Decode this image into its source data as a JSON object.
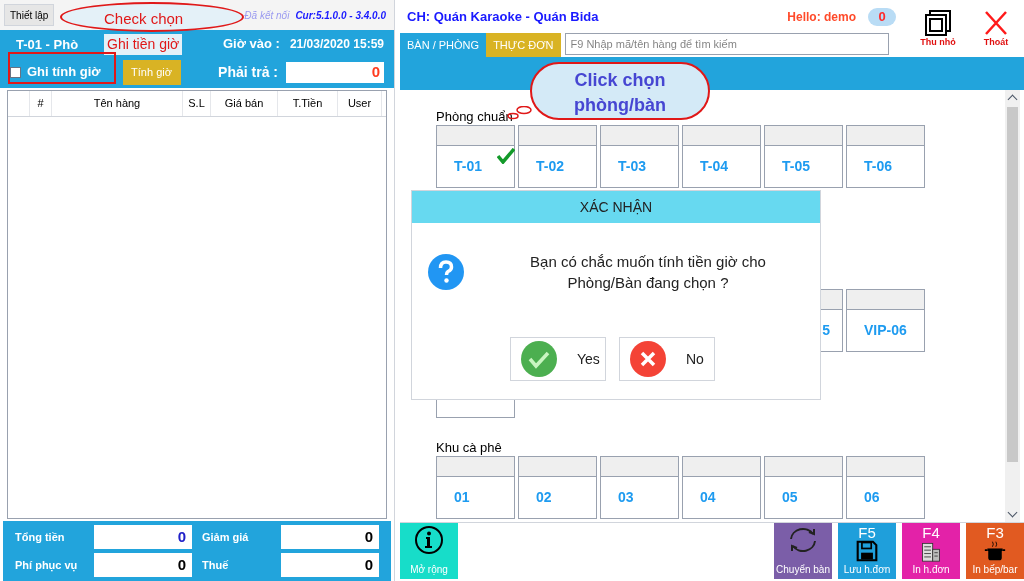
{
  "top_bar": {
    "menu_tab": "Thiết lập",
    "connection": "Đã kết nối",
    "version": "Cur:5.1.0.0 - 3.4.0.0"
  },
  "order_panel": {
    "title": "T-01 - Phò",
    "checkin_label": "Giờ vào :",
    "checkin_time": "21/03/2020 15:59",
    "timer_checkbox": {
      "label": "Ghi tính giờ",
      "checked": false
    },
    "timer_button": "Tính giờ",
    "amount_due_label": "Phải trả :",
    "amount_due": "0"
  },
  "order_table": {
    "columns": [
      "#",
      "Tên hàng",
      "S.L",
      "Giá bán",
      "T.Tiền",
      "User"
    ]
  },
  "totals": [
    {
      "label": "Tổng tiền",
      "value": "0",
      "kind": "total"
    },
    {
      "label": "Giảm giá",
      "value": "0",
      "kind": "plain"
    },
    {
      "label": "Phí phục vụ",
      "value": "0",
      "kind": "plain"
    },
    {
      "label": "Thuế",
      "value": "0",
      "kind": "plain"
    }
  ],
  "store_name": "CH: Quán Karaoke - Quán Bida",
  "greeting": "Hello: demo",
  "notification_count": "0",
  "window_buttons": [
    {
      "label": "Thu nhỏ",
      "kind": "minimize"
    },
    {
      "label": "Thoát",
      "kind": "close"
    }
  ],
  "tabs": [
    {
      "label": "BÀN / PHÒNG",
      "selected": true
    },
    {
      "label": "THỰC ĐƠN",
      "selected": false
    }
  ],
  "search": {
    "placeholder": "F9 Nhập mã/tên hàng để tìm kiếm"
  },
  "areas": [
    {
      "title": "Phòng chuẩn",
      "rows": [
        [
          {
            "label": "T-01",
            "checked": true
          },
          {
            "label": "T-02",
            "checked": false
          },
          {
            "label": "T-03",
            "checked": false
          },
          {
            "label": "T-04",
            "checked": false
          },
          {
            "label": "T-05",
            "checked": false
          },
          {
            "label": "T-06",
            "checked": false
          }
        ],
        null
      ]
    },
    {
      "rows": [
        [
          null,
          null,
          null,
          null,
          {
            "label": "5",
            "kind": "cut",
            "checked": false
          },
          {
            "label": "VIP-06",
            "checked": false
          }
        ],
        [
          {
            "kind": "blank"
          }
        ]
      ]
    },
    {
      "title": "Khu cà phê",
      "rows": [
        [
          {
            "label": "01",
            "checked": false
          },
          {
            "label": "02",
            "checked": false
          },
          {
            "label": "03",
            "checked": false
          },
          {
            "label": "04",
            "checked": false
          },
          {
            "label": "05",
            "checked": false
          },
          {
            "label": "06",
            "checked": false
          }
        ]
      ]
    }
  ],
  "dialog": {
    "title": "XÁC NHẬN",
    "message": "Bạn có chắc muốn tính tiền giờ cho Phòng/Bàn đang chọn ?",
    "buttons": [
      {
        "label": "Yes",
        "kind": "yes"
      },
      {
        "label": "No",
        "kind": "no"
      }
    ]
  },
  "toolbar": [
    {
      "label": "Mở rộng",
      "kind": "info"
    },
    {
      "label": "Chuyển bàn",
      "kind": "move"
    },
    {
      "label": "Lưu h.đơn",
      "key": "F5",
      "kind": "save"
    },
    {
      "label": "In h.đơn",
      "key": "F4",
      "kind": "print"
    },
    {
      "label": "In bếp/bar",
      "key": "F3",
      "kind": "kitchen"
    }
  ],
  "annotations": [
    {
      "lines": [
        "Check chọn",
        "Ghi tiền giờ"
      ],
      "kind": "checkbox"
    },
    {
      "lines": [
        "Click chọn",
        "phòng/bàn"
      ],
      "kind": "room"
    }
  ]
}
